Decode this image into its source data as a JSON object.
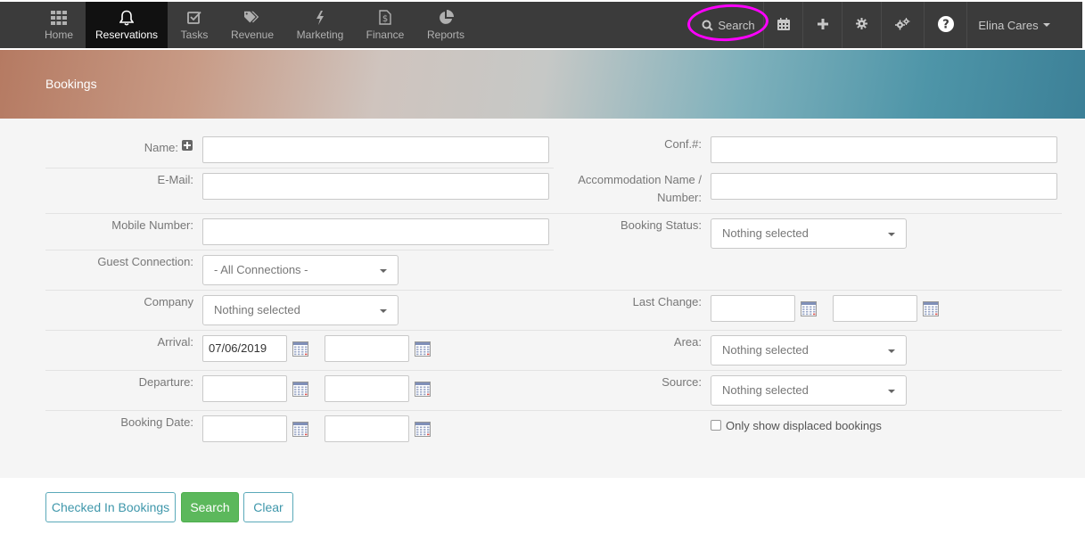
{
  "nav": {
    "items": [
      {
        "label": "Home",
        "icon": "grid-icon"
      },
      {
        "label": "Reservations",
        "icon": "bell-icon"
      },
      {
        "label": "Tasks",
        "icon": "checkbox-icon"
      },
      {
        "label": "Revenue",
        "icon": "tags-icon"
      },
      {
        "label": "Marketing",
        "icon": "bolt-icon"
      },
      {
        "label": "Finance",
        "icon": "dollar-file-icon"
      },
      {
        "label": "Reports",
        "icon": "pie-chart-icon"
      }
    ],
    "active": "Reservations",
    "search_label": "Search",
    "user_name": "Elina Cares",
    "colors": {
      "bar": "#3b3b3b",
      "active": "#111111",
      "highlight": "#ff00ff"
    }
  },
  "banner": {
    "title": "Bookings"
  },
  "form": {
    "name_label": "Name:",
    "email_label": "E-Mail:",
    "mobile_label": "Mobile Number:",
    "guest_connection_label": "Guest Connection:",
    "guest_connection_value": "- All Connections -",
    "company_label": "Company",
    "company_value": "Nothing selected",
    "arrival_label": "Arrival:",
    "arrival_from": "07/06/2019",
    "departure_label": "Departure:",
    "booking_date_label": "Booking Date:",
    "conf_label": "Conf.#:",
    "accommodation_label_1": "Accommodation Name /",
    "accommodation_label_2": "Number:",
    "booking_status_label": "Booking Status:",
    "booking_status_value": "Nothing selected",
    "last_change_label": "Last Change:",
    "area_label": "Area:",
    "area_value": "Nothing selected",
    "source_label": "Source:",
    "source_value": "Nothing selected",
    "displaced_label": "Only show displaced bookings"
  },
  "actions": {
    "checked_in": "Checked In Bookings",
    "search": "Search",
    "clear": "Clear",
    "colors": {
      "primary_green": "#5cb85c",
      "outline": "#5aa9b9"
    }
  }
}
